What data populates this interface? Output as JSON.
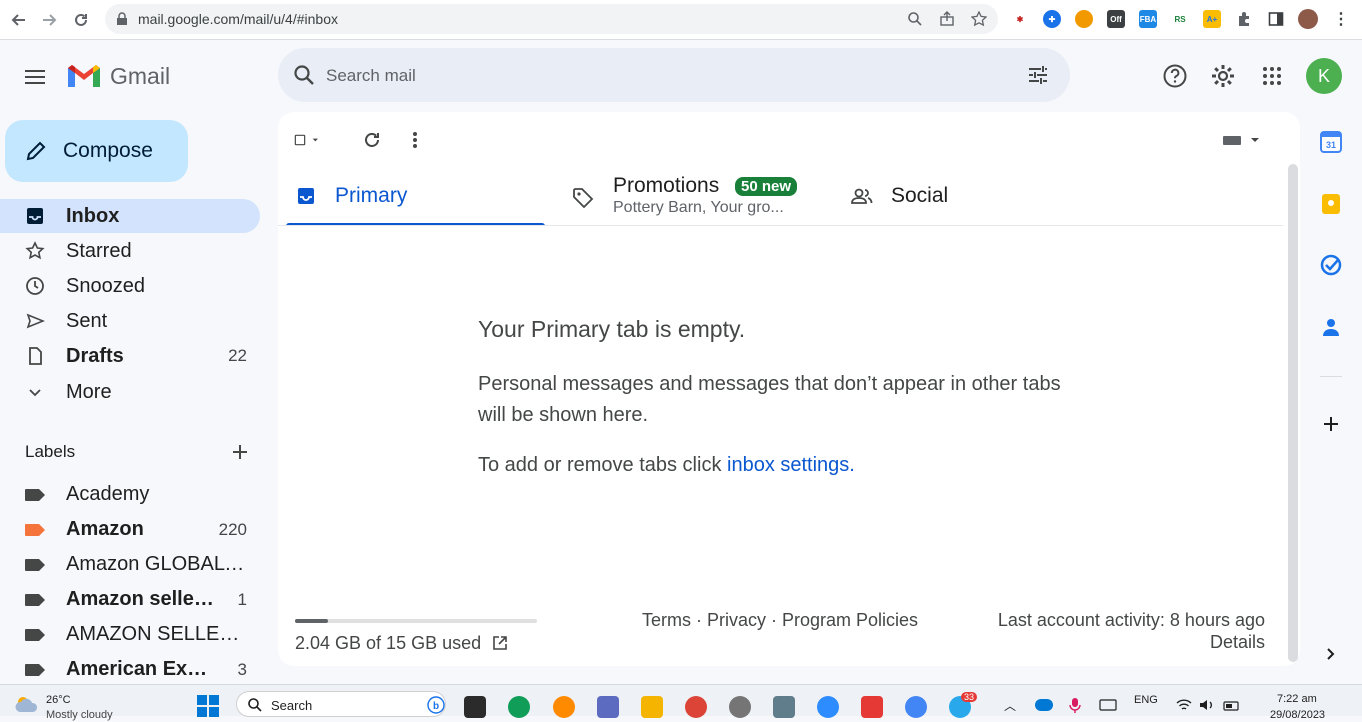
{
  "browser": {
    "url": "mail.google.com/mail/u/4/#inbox"
  },
  "header": {
    "app_name": "Gmail",
    "search_placeholder": "Search mail",
    "avatar_letter": "K"
  },
  "sidebar": {
    "compose_label": "Compose",
    "items": [
      {
        "label": "Inbox",
        "count": "",
        "icon": "inbox-icon",
        "active": true,
        "bold": true
      },
      {
        "label": "Starred",
        "count": "",
        "icon": "star-icon",
        "active": false,
        "bold": false
      },
      {
        "label": "Snoozed",
        "count": "",
        "icon": "clock-icon",
        "active": false,
        "bold": false
      },
      {
        "label": "Sent",
        "count": "",
        "icon": "send-icon",
        "active": false,
        "bold": false
      },
      {
        "label": "Drafts",
        "count": "22",
        "icon": "draft-icon",
        "active": false,
        "bold": true
      },
      {
        "label": "More",
        "count": "",
        "icon": "chevron-down-icon",
        "active": false,
        "bold": false
      }
    ],
    "labels_heading": "Labels",
    "labels": [
      {
        "name": "Academy",
        "count": "",
        "bold": false,
        "color": "#444746"
      },
      {
        "name": "Amazon",
        "count": "220",
        "bold": true,
        "color": "#f4743b"
      },
      {
        "name": "Amazon GLOBAL SELLING",
        "count": "",
        "bold": false,
        "color": "#444746"
      },
      {
        "name": "Amazon seller central",
        "count": "1",
        "bold": true,
        "color": "#444746"
      },
      {
        "name": "AMAZON SELLER CENTRAL",
        "count": "",
        "bold": false,
        "color": "#444746"
      },
      {
        "name": "American Express",
        "count": "3",
        "bold": true,
        "color": "#444746"
      }
    ]
  },
  "tabs": {
    "primary": "Primary",
    "promotions": "Promotions",
    "promotions_badge": "50 new",
    "promotions_sub": "Pottery Barn, Your gro...",
    "social": "Social"
  },
  "empty_state": {
    "title": "Your Primary tab is empty.",
    "body": "Personal messages and messages that don’t appear in other tabs will be shown here.",
    "settings_prefix": "To add or remove tabs click ",
    "settings_link": "inbox settings",
    "settings_suffix": "."
  },
  "footer": {
    "storage_text": "2.04 GB of 15 GB used",
    "storage_fraction": 0.136,
    "links": "Terms · Privacy · Program Policies",
    "last_activity": "Last account activity: 8 hours ago",
    "details": "Details"
  },
  "taskbar": {
    "temperature": "26°C",
    "weather": "Mostly cloudy",
    "search": "Search",
    "notification_count": "33",
    "lang": "ENG",
    "time": "7:22 am",
    "date": "29/08/2023"
  },
  "colors": {
    "accent": "#0b57d0",
    "compose": "#c2e7ff",
    "active_nav": "#d3e3fd",
    "badge": "#188038"
  }
}
